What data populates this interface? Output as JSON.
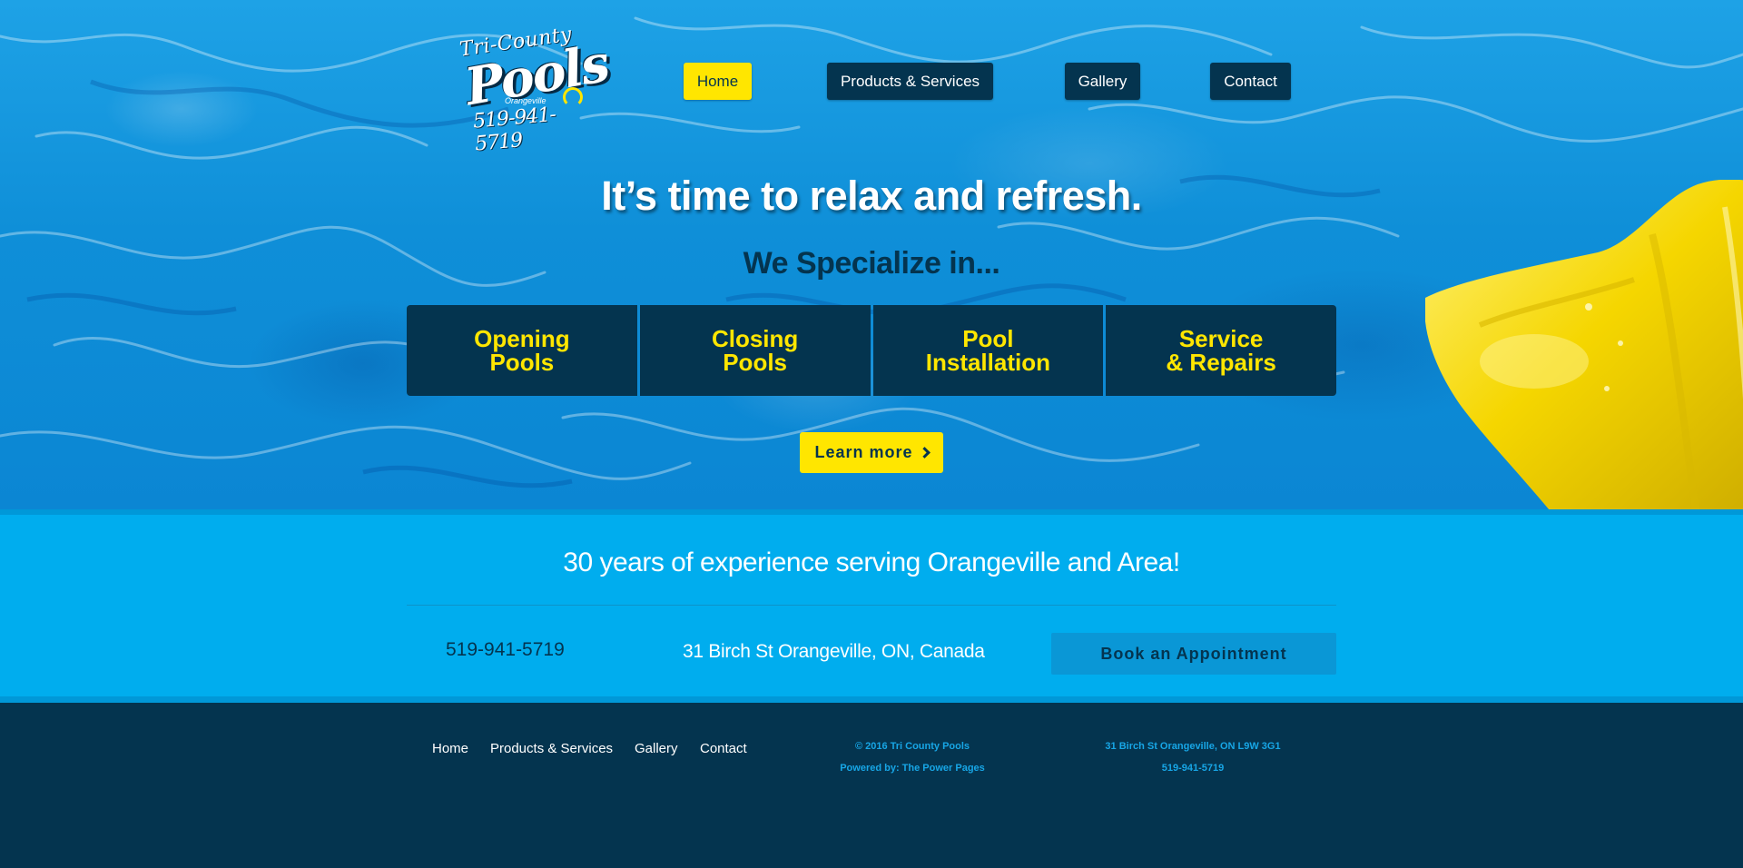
{
  "logo": {
    "line1": "Tri-County",
    "line2": "Pools",
    "line3": "Orangeville",
    "line4": "519-941-5719"
  },
  "nav": {
    "items": [
      {
        "label": "Home",
        "active": true
      },
      {
        "label": "Products & Services",
        "active": false
      },
      {
        "label": "Gallery",
        "active": false
      },
      {
        "label": "Contact",
        "active": false
      }
    ]
  },
  "hero": {
    "headline": "It’s time to relax and refresh.",
    "subhead": "We Specialize in...",
    "services": [
      "Opening\nPools",
      "Closing\nPools",
      "Pool\nInstallation",
      "Service\n& Repairs"
    ],
    "learn_more": "Learn more"
  },
  "band": {
    "tagline": "30 years of experience serving Orangeville and Area!",
    "phone": "519-941-5719",
    "address": "31 Birch St Orangeville, ON, Canada",
    "book_button": "Book an Appointment"
  },
  "footer": {
    "nav": [
      "Home",
      "Products & Services",
      "Gallery",
      "Contact"
    ],
    "copyright": "© 2016 Tri County Pools",
    "powered_by": "Powered by: The Power Pages",
    "address": "31 Birch St Orangeville, ON L9W 3G1",
    "phone": "519-941-5719"
  },
  "colors": {
    "navy": "#04344f",
    "yellow": "#ffe600",
    "band_blue": "#00adee",
    "footer_link_blue": "#17a6e6"
  }
}
